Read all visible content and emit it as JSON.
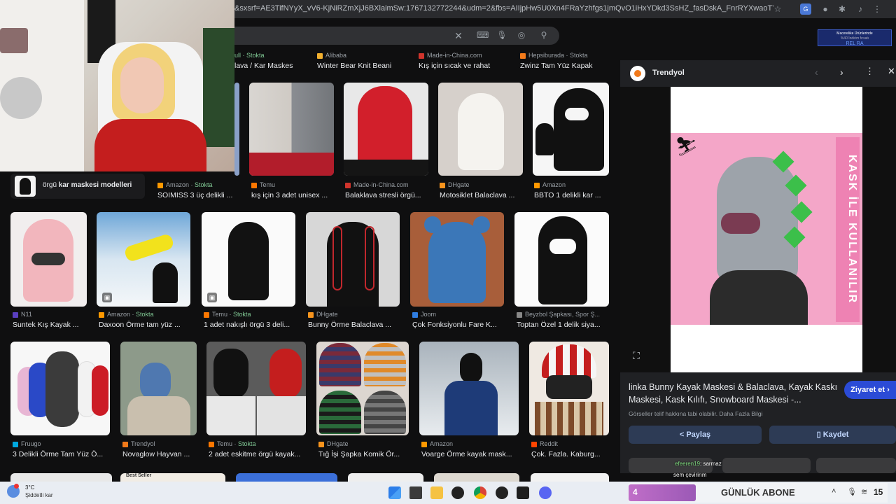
{
  "browser": {
    "url": "&sxsrf=AE3TifNYyX_vV6-KjNiRZmXjJ6BXlaimSw:1767132772244&udm=2&fbs=AIIjpHw5U0Xn4FRaYzhfgs1jmQvO1iHxYDkd3SsHZ_fasDskA_FnrRYXwaoTYk_bFZyqo...",
    "extension_label": "Macerelike Ürünlerinde",
    "extension_sub": "%40 İndirim fırsatı",
    "extension_brand": "REL   RA"
  },
  "related_search": {
    "label_prefix": "örgü ",
    "label_bold": "kar maskesi",
    "label_mid": " ",
    "label_bold2": "modelleri"
  },
  "top_strip": [
    {
      "source": "ull · Stokta",
      "title": "lava / Kar Maskes"
    },
    {
      "source": "Alibaba",
      "title": "Winter Bear Knit Beani"
    },
    {
      "source": "Made-in-China.com",
      "title": "Kış için sıcak ve rahat"
    },
    {
      "source": "Hepsiburada · Stokta",
      "title": "Zwinz Tam Yüz Kapak"
    }
  ],
  "row1": [
    {
      "source": "Amazon",
      "stock": "Stokta",
      "title": "SOIMISS 3 üç delikli ..."
    },
    {
      "source": "Temu",
      "stock": "",
      "title": "kış için 3 adet unisex ..."
    },
    {
      "source": "Made-in-China.com",
      "stock": "",
      "title": "Balaklava stresli örgü..."
    },
    {
      "source": "DHgate",
      "stock": "",
      "title": "Motosiklet Balaclava ..."
    },
    {
      "source": "Amazon",
      "stock": "",
      "title": "BBTO 1 delikli kar ..."
    }
  ],
  "row2": [
    {
      "source": "N11",
      "stock": "",
      "title": "Suntek Kış Kayak ..."
    },
    {
      "source": "Amazon",
      "stock": "Stokta",
      "title": "Daxoon Örme tam yüz ..."
    },
    {
      "source": "Temu",
      "stock": "Stokta",
      "title": "1 adet nakışlı örgü 3 deli..."
    },
    {
      "source": "DHgate",
      "stock": "",
      "title": "Bunny Örme Balaclava ..."
    },
    {
      "source": "Joom",
      "stock": "",
      "title": "Çok Fonksiyonlu Fare K..."
    },
    {
      "source": "Beyzbol Şapkası, Spor Ş...",
      "stock": "",
      "title": "Toptan Özel 1 delik siya..."
    }
  ],
  "row3": [
    {
      "source": "Fruugo",
      "stock": "",
      "title": "3 Delikli Örme Tam Yüz Ö..."
    },
    {
      "source": "Trendyol",
      "stock": "",
      "title": "Novaglow Hayvan ..."
    },
    {
      "source": "Temu",
      "stock": "Stokta",
      "title": "2 adet eskitme örgü kayak..."
    },
    {
      "source": "DHgate",
      "stock": "",
      "title": "Tığ İşi Şapka Komik Ör..."
    },
    {
      "source": "Amazon",
      "stock": "",
      "title": "Voarge Örme kayak mask..."
    },
    {
      "source": "Reddit",
      "stock": "",
      "title": "Çok. Fazla. Kaburg..."
    }
  ],
  "bottom_peek": {
    "label": "Best Seller"
  },
  "panel": {
    "site": "Trendyol",
    "image_text": "KASK İLE KULLANILIR",
    "title": "linka Bunny Kayak Maskesi & Balaclava, Kayak Kaskı Maskesi, Kask Kılıfı, Snowboard Maskesi -...",
    "visit_label": "Ziyaret et",
    "notice": "Görseller telif hakkına tabi olabilir.",
    "more_info": "Daha Fazla Bilgi",
    "share_label": "Paylaş",
    "save_label": "Kaydet"
  },
  "chat": {
    "user": "efeeren19",
    "message": ": sarmaz",
    "line2": "sem çevirirım"
  },
  "stream_overlay": {
    "count": "4",
    "label": "GÜNLÜK ABONE"
  },
  "taskbar": {
    "weather_temp": "3°C",
    "weather_desc": "Şiddetli kar",
    "clock": "15"
  },
  "colors": {
    "accent": "#8ab4f8",
    "stock_green": "#81c995",
    "panel_bg": "#202124",
    "pill_bg": "#2d3b55"
  }
}
